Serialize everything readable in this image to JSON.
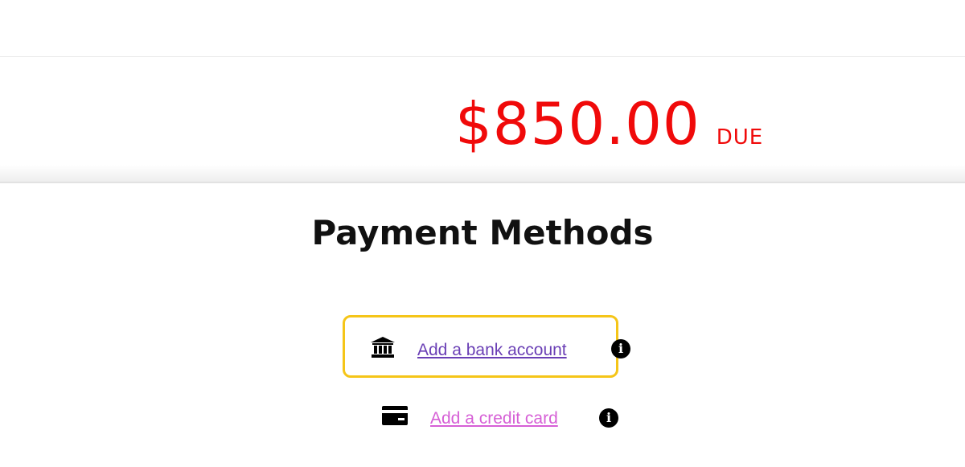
{
  "summary": {
    "amount": "$850.00",
    "status": "DUE",
    "amount_color": "#f00a0a"
  },
  "payment_methods": {
    "title": "Payment Methods",
    "bank": {
      "label": "Add a bank account",
      "icon": "bank-icon",
      "info_icon": "info-icon",
      "highlighted": true,
      "highlight_color": "#f5c518"
    },
    "card": {
      "label": "Add a credit card",
      "icon": "credit-card-icon",
      "info_icon": "info-icon"
    },
    "info_glyph": "i"
  }
}
